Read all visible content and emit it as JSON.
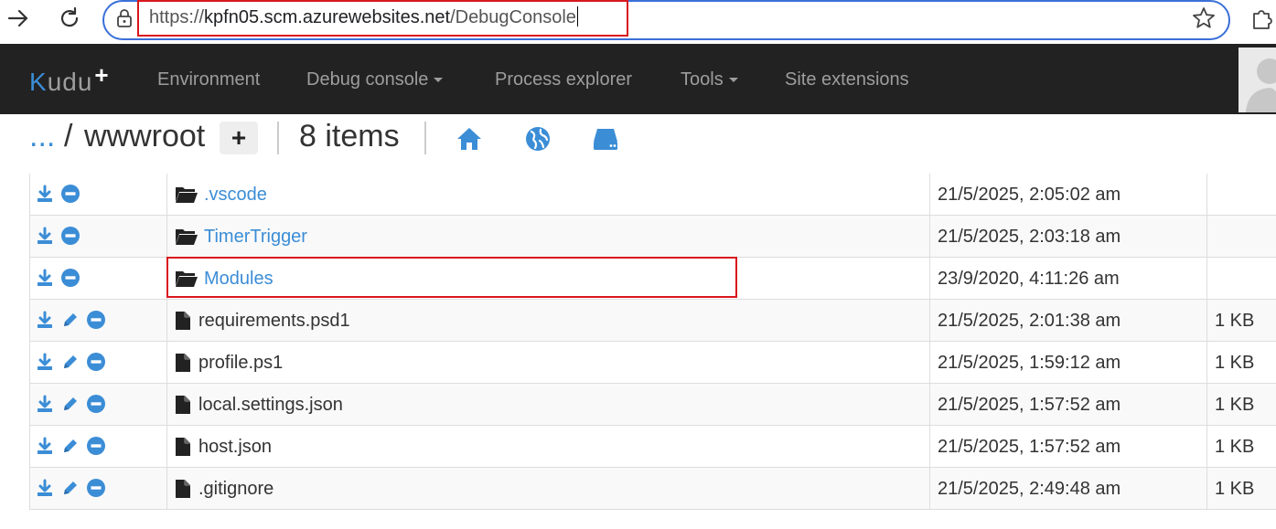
{
  "browser": {
    "url_scheme": "https://",
    "url_host": "kpfn05.scm.azurewebsites.net",
    "url_path": "/DebugConsole"
  },
  "kudu": {
    "brand_k": "K",
    "brand_rest": "udu",
    "brand_plus": "+",
    "nav": {
      "environment": "Environment",
      "debug_console": "Debug console",
      "process_explorer": "Process explorer",
      "tools": "Tools",
      "site_extensions": "Site extensions"
    }
  },
  "breadcrumb": {
    "ellipsis": "...",
    "separator": "/",
    "current_dir": "wwwroot",
    "add_label": "+",
    "item_count": "8 items"
  },
  "colors": {
    "accent_blue": "#3b8dd6",
    "navbar": "#222222",
    "highlight_red": "#d9161d"
  },
  "files": [
    {
      "type": "folder",
      "name": ".vscode",
      "modified": "21/5/2025, 2:05:02 am",
      "size": ""
    },
    {
      "type": "folder",
      "name": "TimerTrigger",
      "modified": "21/5/2025, 2:03:18 am",
      "size": ""
    },
    {
      "type": "folder",
      "name": "Modules",
      "modified": "23/9/2020, 4:11:26 am",
      "size": ""
    },
    {
      "type": "file",
      "name": "requirements.psd1",
      "modified": "21/5/2025, 2:01:38 am",
      "size": "1 KB"
    },
    {
      "type": "file",
      "name": "profile.ps1",
      "modified": "21/5/2025, 1:59:12 am",
      "size": "1 KB"
    },
    {
      "type": "file",
      "name": "local.settings.json",
      "modified": "21/5/2025, 1:57:52 am",
      "size": "1 KB"
    },
    {
      "type": "file",
      "name": "host.json",
      "modified": "21/5/2025, 1:57:52 am",
      "size": "1 KB"
    },
    {
      "type": "file",
      "name": ".gitignore",
      "modified": "21/5/2025, 2:49:48 am",
      "size": "1 KB"
    }
  ]
}
